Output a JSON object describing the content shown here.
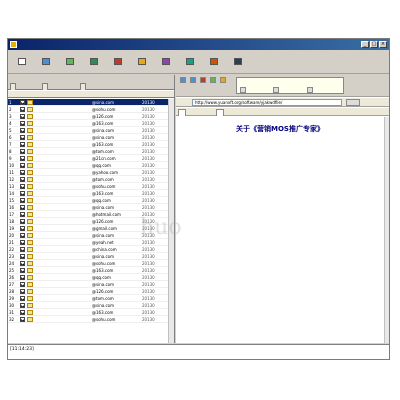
{
  "window": {
    "title": "",
    "controls": [
      "_",
      "□",
      "×"
    ]
  },
  "menu": [
    "",
    "",
    "",
    "",
    "",
    ""
  ],
  "toolbar": [
    {
      "label": "",
      "icon": "new-icon"
    },
    {
      "label": "",
      "icon": "import-icon"
    },
    {
      "label": "",
      "icon": "import-file-icon"
    },
    {
      "label": "",
      "icon": "start-icon"
    },
    {
      "label": "",
      "icon": "stop-icon"
    },
    {
      "label": "",
      "icon": "resume-icon"
    },
    {
      "label": "",
      "icon": "filter-icon"
    },
    {
      "label": "",
      "icon": "export-icon"
    },
    {
      "label": "",
      "icon": "register-icon"
    },
    {
      "label": "",
      "icon": "help-icon"
    }
  ],
  "left": {
    "header": "",
    "tabs": [
      "",
      "",
      ""
    ],
    "columns": [
      "",
      "",
      "",
      "",
      "",
      ""
    ],
    "rows": [
      {
        "num": "1",
        "checked": true,
        "name": "",
        "email": "@sina.com",
        "port": "20130"
      },
      {
        "num": "2",
        "checked": true,
        "name": "",
        "email": "@sohu.com",
        "port": "20130"
      },
      {
        "num": "3",
        "checked": true,
        "name": "",
        "email": "@126.com",
        "port": "20130"
      },
      {
        "num": "4",
        "checked": true,
        "name": "",
        "email": "@163.com",
        "port": "20130"
      },
      {
        "num": "5",
        "checked": true,
        "name": "",
        "email": "@sina.com",
        "port": "20130"
      },
      {
        "num": "6",
        "checked": true,
        "name": "",
        "email": "@sina.com",
        "port": "20130"
      },
      {
        "num": "7",
        "checked": true,
        "name": "",
        "email": "@163.com",
        "port": "20130"
      },
      {
        "num": "8",
        "checked": true,
        "name": "",
        "email": "@tom.com",
        "port": "20130"
      },
      {
        "num": "9",
        "checked": true,
        "name": "",
        "email": "@21cn.com",
        "port": "20130"
      },
      {
        "num": "10",
        "checked": true,
        "name": "",
        "email": "@qq.com",
        "port": "20130"
      },
      {
        "num": "11",
        "checked": true,
        "name": "",
        "email": "@yahoo.com",
        "port": "20130"
      },
      {
        "num": "12",
        "checked": true,
        "name": "",
        "email": "@tom.com",
        "port": "20130"
      },
      {
        "num": "13",
        "checked": true,
        "name": "",
        "email": "@sohu.com",
        "port": "20130"
      },
      {
        "num": "14",
        "checked": true,
        "name": "",
        "email": "@163.com",
        "port": "20130"
      },
      {
        "num": "15",
        "checked": true,
        "name": "",
        "email": "@qq.com",
        "port": "20130"
      },
      {
        "num": "16",
        "checked": true,
        "name": "",
        "email": "@sina.com",
        "port": "20130"
      },
      {
        "num": "17",
        "checked": true,
        "name": "",
        "email": "@hotmail.com",
        "port": "20130"
      },
      {
        "num": "18",
        "checked": true,
        "name": "",
        "email": "@126.com",
        "port": "20130"
      },
      {
        "num": "19",
        "checked": true,
        "name": "",
        "email": "@gmail.com",
        "port": "20130"
      },
      {
        "num": "20",
        "checked": true,
        "name": "",
        "email": "@sina.com",
        "port": "20130"
      },
      {
        "num": "21",
        "checked": true,
        "name": "",
        "email": "@yeah.net",
        "port": "20130"
      },
      {
        "num": "22",
        "checked": true,
        "name": "",
        "email": "@china.com",
        "port": "20130"
      },
      {
        "num": "23",
        "checked": true,
        "name": "",
        "email": "@sina.com",
        "port": "20130"
      },
      {
        "num": "24",
        "checked": true,
        "name": "",
        "email": "@sohu.com",
        "port": "20130"
      },
      {
        "num": "25",
        "checked": true,
        "name": "",
        "email": "@163.com",
        "port": "20130"
      },
      {
        "num": "26",
        "checked": true,
        "name": "",
        "email": "@qq.com",
        "port": "20130"
      },
      {
        "num": "27",
        "checked": true,
        "name": "",
        "email": "@sina.com",
        "port": "20130"
      },
      {
        "num": "28",
        "checked": true,
        "name": "",
        "email": "@126.com",
        "port": "20130"
      },
      {
        "num": "29",
        "checked": true,
        "name": "",
        "email": "@tom.com",
        "port": "20130"
      },
      {
        "num": "30",
        "checked": true,
        "name": "",
        "email": "@sina.com",
        "port": "20130"
      },
      {
        "num": "31",
        "checked": true,
        "name": "",
        "email": "@163.com",
        "port": "20130"
      },
      {
        "num": "32",
        "checked": true,
        "name": "",
        "email": "@sohu.com",
        "port": "20130"
      }
    ]
  },
  "right": {
    "toolbar_labels": [
      "",
      "",
      "",
      "",
      ""
    ],
    "popup": {
      "title": "",
      "actions": [
        "",
        "",
        ""
      ]
    },
    "address_label": "",
    "address": "http://www.yuanxft.org/software/yjakwdfile/",
    "go_label": "",
    "page_tabs": [
      "",
      ""
    ],
    "doc": {
      "title": "关于《营销MOS推广专家》",
      "paragraphs": [
        "",
        "",
        ""
      ],
      "headings": [
        "",
        "",
        ""
      ],
      "list": [
        "",
        "",
        "",
        "",
        "",
        "",
        "",
        ""
      ],
      "links": [
        "",
        "",
        "",
        "",
        ""
      ]
    }
  },
  "log": "[11:14:23]",
  "watermark": "huo"
}
